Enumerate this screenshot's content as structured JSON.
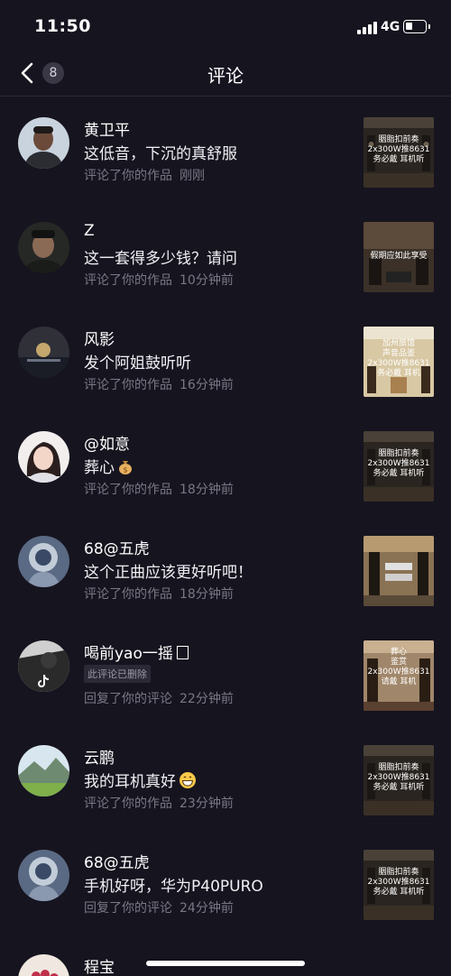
{
  "status": {
    "time": "11:50",
    "network": "4G"
  },
  "header": {
    "title": "评论",
    "unread_count": "8"
  },
  "comments": [
    {
      "name": "黄卫平",
      "text": "这低音，下沉的真舒服",
      "action": "评论了你的作品",
      "time": "刚刚",
      "thumb_caption": "胭脂扣前奏\n2x300W推8631\n务必戴 耳机听"
    },
    {
      "name": "Z",
      "text": "这一套得多少钱？请问",
      "action": "评论了你的作品",
      "time": "10分钟前",
      "thumb_caption": "假期应如此享受"
    },
    {
      "name": "风影",
      "text": "发个阿姐鼓听听",
      "action": "评论了你的作品",
      "time": "16分钟前",
      "thumb_caption": "加州旅馆\n声音品鉴\n2x300W推8631\n务必戴 耳机"
    },
    {
      "name": "@如意",
      "text": "葬心",
      "action": "评论了你的作品",
      "time": "18分钟前",
      "thumb_caption": "胭脂扣前奏\n2x300W推8631\n务必戴 耳机听"
    },
    {
      "name": "68@五虎",
      "text": "这个正曲应该更好听吧！",
      "action": "评论了你的作品",
      "time": "18分钟前",
      "thumb_caption": ""
    },
    {
      "name": "喝前yao一摇",
      "deleted_label": "此评论已删除",
      "action": "回复了你的评论",
      "time": "22分钟前",
      "thumb_caption": "葬心\n鉴赏\n2x300W推8631\n请戴 耳机"
    },
    {
      "name": "云鹏",
      "text": "我的耳机真好",
      "action": "评论了你的作品",
      "time": "23分钟前",
      "thumb_caption": "胭脂扣前奏\n2x300W推8631\n务必戴 耳机听"
    },
    {
      "name": "68@五虎",
      "text": "手机好呀，华为P40PURO",
      "action": "回复了你的评论",
      "time": "24分钟前",
      "thumb_caption": "胭脂扣前奏\n2x300W推8631\n务必戴 耳机听"
    }
  ],
  "peek": {
    "name": "程宝"
  },
  "icons": {
    "back": "chevron-left-icon",
    "signal": "signal-icon",
    "battery": "battery-icon",
    "money_bag": "money-bag-icon",
    "grin": "grin-icon",
    "tiktok": "tiktok-icon",
    "square": "square-icon"
  },
  "colors": {
    "background": "#16141f",
    "meta_text": "#7a7886",
    "badge": "#3a3845"
  }
}
